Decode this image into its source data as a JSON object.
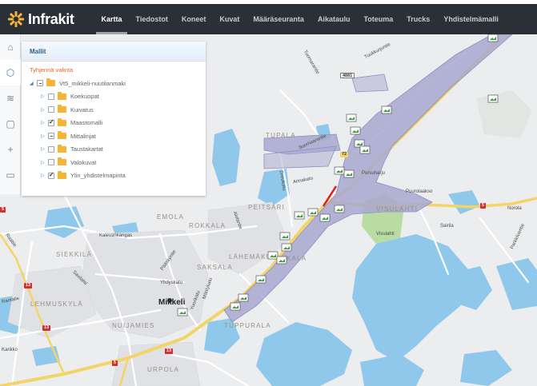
{
  "app": {
    "logo_text": "Infrakit"
  },
  "nav": {
    "items": [
      {
        "label": "Kartta",
        "active": true
      },
      {
        "label": "Tiedostot",
        "active": false
      },
      {
        "label": "Koneet",
        "active": false
      },
      {
        "label": "Kuvat",
        "active": false
      },
      {
        "label": "Määräseuranta",
        "active": false
      },
      {
        "label": "Aikataulu",
        "active": false
      },
      {
        "label": "Toteuma",
        "active": false
      },
      {
        "label": "Trucks",
        "active": false
      },
      {
        "label": "Yhdistelmämalli",
        "active": false
      }
    ]
  },
  "rail": {
    "tools": [
      {
        "icon": "map-layers-icon",
        "glyph": "⌂"
      },
      {
        "icon": "cube-icon",
        "glyph": "⬡",
        "active": true
      },
      {
        "icon": "stack-icon",
        "glyph": "≋"
      },
      {
        "icon": "document-icon",
        "glyph": "▢"
      },
      {
        "icon": "add-icon",
        "glyph": "+"
      },
      {
        "icon": "image-icon",
        "glyph": "▭"
      }
    ]
  },
  "panel": {
    "title": "Mallit",
    "clear_label": "Tyhjennä valinta",
    "root": {
      "label": "Vt5_mikkeli-nuutilanmaki",
      "state": "partial"
    },
    "children": [
      {
        "label": "Koekuopat",
        "state": "unchecked"
      },
      {
        "label": "Kuivatus",
        "state": "unchecked"
      },
      {
        "label": "Maastomalli",
        "state": "checked"
      },
      {
        "label": "Mittalinjat",
        "state": "partial"
      },
      {
        "label": "Taustakartat",
        "state": "unchecked"
      },
      {
        "label": "Valokuvat",
        "state": "unchecked"
      },
      {
        "label": "Ylin_yhdistelmapinta",
        "state": "checked"
      }
    ]
  },
  "map": {
    "districts": [
      "TUPALA",
      "PEITSARI",
      "VISULAHTI",
      "EMOLA",
      "ROKKALA",
      "LÄHEMÄKI",
      "KALA",
      "SIEKKILÄ",
      "SAKSALA",
      "LEHMUSKYLÄ",
      "NUIJAMIES",
      "TUPPURALA",
      "URPOLA"
    ],
    "city": "Mikkeli",
    "streets": [
      "Tuukkurjuntie",
      "Tuomarantie",
      "Suomaarentie",
      "Drevikatu",
      "Arinakatu",
      "Pursuharju",
      "Puurolaakso",
      "Sairila",
      "Norola",
      "Parkkiluentie",
      "Visulahti",
      "Kalevankangas",
      "Raatiie",
      "Alolantie",
      "Savilahti",
      "Pääskyntie",
      "Yhdyskatu",
      "Yuorikatu",
      "Karikko",
      "Mäntykatu",
      "Rantatie"
    ],
    "road_numbers": [
      "4881",
      "72",
      "5",
      "13",
      "15",
      "5",
      "5"
    ],
    "colors": {
      "water": "#90c9ea",
      "project": "#a9a9cf",
      "highway": "#f3d567",
      "park": "#b8dca1"
    }
  }
}
